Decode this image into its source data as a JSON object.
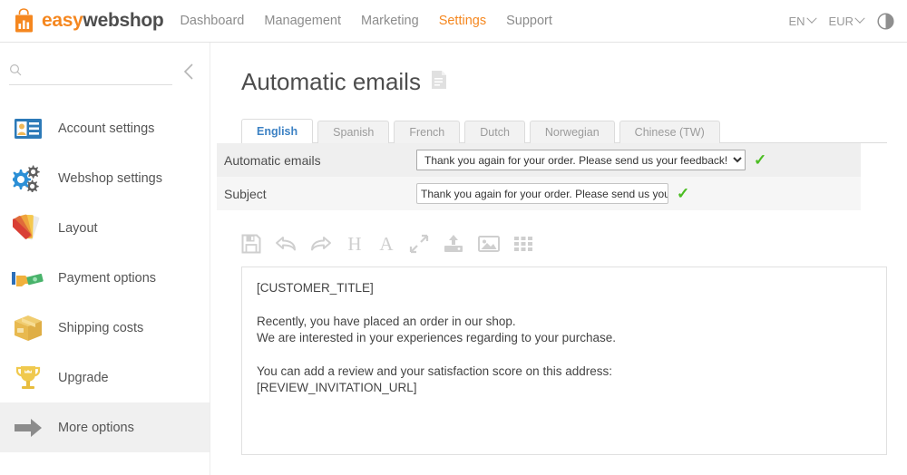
{
  "brand": {
    "name_part1": "easy",
    "name_part2": "webshop",
    "logo_icon": "shopping-bag-chart-icon",
    "accent_color": "#f5871f",
    "dark_color": "#4d4d4d"
  },
  "topnav": {
    "items": [
      {
        "label": "Dashboard",
        "active": false
      },
      {
        "label": "Management",
        "active": false
      },
      {
        "label": "Marketing",
        "active": false
      },
      {
        "label": "Settings",
        "active": true
      },
      {
        "label": "Support",
        "active": false
      }
    ],
    "language_selector": "EN",
    "currency_selector": "EUR",
    "theme_toggle_icon": "contrast-circle-icon"
  },
  "sidebar": {
    "search_placeholder": "",
    "search_value": "",
    "search_icon": "search-icon",
    "collapse_icon": "chevron-left-icon",
    "items": [
      {
        "label": "Account settings",
        "icon": "id-card-icon",
        "selected": false
      },
      {
        "label": "Webshop settings",
        "icon": "gears-icon",
        "selected": false
      },
      {
        "label": "Layout",
        "icon": "color-swatches-icon",
        "selected": false
      },
      {
        "label": "Payment options",
        "icon": "hand-money-icon",
        "selected": false
      },
      {
        "label": "Shipping costs",
        "icon": "package-box-icon",
        "selected": false
      },
      {
        "label": "Upgrade",
        "icon": "trophy-icon",
        "selected": false
      },
      {
        "label": "More options",
        "icon": "arrow-right-icon",
        "selected": true
      }
    ]
  },
  "page": {
    "title": "Automatic emails",
    "title_icon": "document-page-icon"
  },
  "language_tabs": [
    {
      "label": "English",
      "active": true
    },
    {
      "label": "Spanish",
      "active": false
    },
    {
      "label": "French",
      "active": false
    },
    {
      "label": "Dutch",
      "active": false
    },
    {
      "label": "Norwegian",
      "active": false
    },
    {
      "label": "Chinese (TW)",
      "active": false
    }
  ],
  "form": {
    "rows": [
      {
        "label": "Automatic emails",
        "type": "select",
        "value": "Thank you again for your order. Please send us your feedback!",
        "options": [
          "Thank you again for your order. Please send us your feedback!"
        ],
        "status_icon": "green-check-icon"
      },
      {
        "label": "Subject",
        "type": "text",
        "value": "Thank you again for your order. Please send us your feedback!",
        "placeholder": "",
        "status_icon": "green-check-icon"
      }
    ]
  },
  "editor": {
    "toolbar": [
      {
        "name": "save-icon",
        "title": "Save"
      },
      {
        "name": "undo-icon",
        "title": "Undo"
      },
      {
        "name": "redo-icon",
        "title": "Redo"
      },
      {
        "name": "heading-icon",
        "title": "H"
      },
      {
        "name": "font-icon",
        "title": "A"
      },
      {
        "name": "fullscreen-icon",
        "title": "Fullscreen"
      },
      {
        "name": "upload-icon",
        "title": "Upload"
      },
      {
        "name": "image-icon",
        "title": "Image"
      },
      {
        "name": "grid-icon",
        "title": "Table"
      }
    ],
    "body": {
      "line1": "[CUSTOMER_TITLE]",
      "line2": "Recently, you have placed an order in our shop.",
      "line3": "We are interested in your experiences regarding to your purchase.",
      "line4": "You can add a review and your satisfaction score on this address:",
      "line5": "[REVIEW_INVITATION_URL]"
    }
  },
  "colors": {
    "accent": "#f5871f",
    "tab_active_text": "#3d82c4",
    "check_green": "#4bbd22",
    "row_odd": "#efefef",
    "row_even": "#f6f6f6"
  }
}
